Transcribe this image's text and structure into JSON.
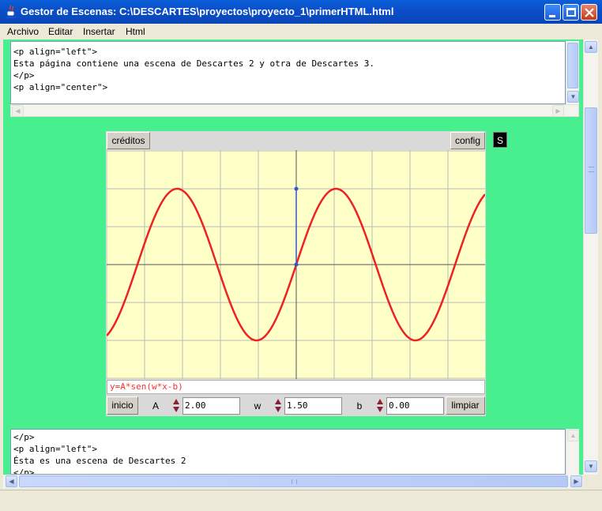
{
  "window": {
    "title": "Gestor de Escenas: C:\\DESCARTES\\proyectos\\proyecto_1\\primerHTML.html"
  },
  "menu": {
    "items": [
      "Archivo",
      "Editar",
      "Insertar",
      "Html"
    ]
  },
  "top_editor": {
    "lines": [
      "<p align=\"left\">",
      "Esta página contiene una escena de Descartes 2 y otra de Descartes 3.",
      "</p>",
      "<p align=\"center\">"
    ]
  },
  "scene": {
    "creditos_label": "créditos",
    "config_label": "config",
    "s_label": "S",
    "formula": "y=A*sen(w*x-b)",
    "inicio_label": "inicio",
    "limpiar_label": "limpiar",
    "controls": [
      {
        "name": "A",
        "value": "2.00"
      },
      {
        "name": "w",
        "value": "1.50"
      },
      {
        "name": "b",
        "value": "0.00"
      }
    ],
    "colors": {
      "curve": "#ee2222",
      "axis": "#3355cc",
      "grid": "#b8b8b8",
      "background": "#ffffc8"
    }
  },
  "chart_data": {
    "type": "line",
    "title": "",
    "xlabel": "",
    "ylabel": "",
    "series": [
      {
        "function": "y=A*sen(w*x-b)",
        "A": 2.0,
        "w": 1.5,
        "b": 0.0
      }
    ],
    "xlim": [
      -5,
      5
    ],
    "ylim": [
      -3,
      3
    ],
    "grid": true,
    "marker": {
      "x": 0,
      "y_from": 0,
      "y_to": 2
    }
  },
  "bottom_editor": {
    "lines": [
      "</p>",
      "<p align=\"left\">",
      "Ésta es una escena de Descartes 2",
      "</p>"
    ]
  }
}
